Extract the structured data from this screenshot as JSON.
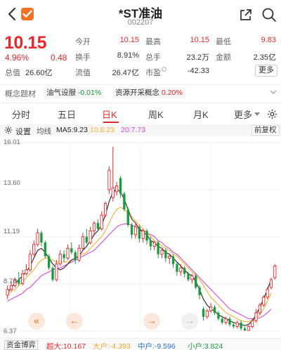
{
  "header": {
    "title": "*ST准油",
    "code": "002207"
  },
  "quote": {
    "price": "10.15",
    "change_pct": "4.96%",
    "change": "0.48",
    "market_cap_label": "总值",
    "market_cap": "26.60亿",
    "row1": [
      {
        "label": "今开",
        "value": "10.15",
        "color": "#e8282b"
      },
      {
        "label": "最高",
        "value": "10.15",
        "color": "#e8282b"
      },
      {
        "label": "最低",
        "value": "9.83",
        "color": "#e8282b"
      }
    ],
    "row2": [
      {
        "label": "换手",
        "value": "8.91%",
        "color": "#333"
      },
      {
        "label": "总手",
        "value": "23.2万",
        "color": "#333"
      },
      {
        "label": "金额",
        "value": "2.35亿",
        "color": "#333"
      }
    ],
    "row3": [
      {
        "label": "流值",
        "value": "26.47亿",
        "color": "#333"
      },
      {
        "label": "市盈",
        "value": "-42.33",
        "color": "#333"
      }
    ],
    "more": "更多"
  },
  "concepts": {
    "label": "概念题材",
    "items": [
      {
        "name": "油气设服",
        "change": "-0.01%"
      },
      {
        "name": "资源开采概念",
        "change": "0.20%"
      }
    ]
  },
  "tabs": [
    "分时",
    "五日",
    "日K",
    "周K",
    "月K",
    "更多"
  ],
  "active_tab": 2,
  "ma": {
    "settings": "设置",
    "label": "均线",
    "ma5": "MA5:9.23",
    "ma10": "10:8.23",
    "ma20": "20:7.73",
    "adjust": "前复权",
    "colors": {
      "ma5": "#222222",
      "ma10": "#f2b134",
      "ma20": "#d44ad8"
    }
  },
  "chart_data": {
    "type": "candlestick",
    "y_labels": [
      "16.01",
      "13.60",
      "11.19",
      "8.78",
      "6.37"
    ],
    "ylim": [
      6.37,
      16.01
    ],
    "candles": [
      {
        "o": 8.2,
        "c": 8.5,
        "h": 8.7,
        "l": 8.0
      },
      {
        "o": 8.5,
        "c": 8.7,
        "h": 8.9,
        "l": 8.4
      },
      {
        "o": 8.7,
        "c": 9.0,
        "h": 9.1,
        "l": 8.6
      },
      {
        "o": 9.0,
        "c": 8.8,
        "h": 9.4,
        "l": 8.7
      },
      {
        "o": 8.8,
        "c": 9.3,
        "h": 9.5,
        "l": 8.7
      },
      {
        "o": 9.3,
        "c": 9.5,
        "h": 9.8,
        "l": 9.2
      },
      {
        "o": 9.5,
        "c": 10.3,
        "h": 10.5,
        "l": 9.4
      },
      {
        "o": 10.3,
        "c": 10.8,
        "h": 11.0,
        "l": 10.2
      },
      {
        "o": 10.8,
        "c": 11.4,
        "h": 11.6,
        "l": 10.7
      },
      {
        "o": 11.4,
        "c": 10.9,
        "h": 11.5,
        "l": 10.7
      },
      {
        "o": 10.9,
        "c": 10.2,
        "h": 11.0,
        "l": 10.1
      },
      {
        "o": 10.2,
        "c": 9.6,
        "h": 10.3,
        "l": 9.5
      },
      {
        "o": 9.6,
        "c": 9.0,
        "h": 9.7,
        "l": 8.9
      },
      {
        "o": 9.0,
        "c": 9.8,
        "h": 10.0,
        "l": 8.9
      },
      {
        "o": 9.8,
        "c": 10.3,
        "h": 10.5,
        "l": 9.7
      },
      {
        "o": 10.3,
        "c": 10.1,
        "h": 10.5,
        "l": 9.9
      },
      {
        "o": 10.1,
        "c": 10.6,
        "h": 10.8,
        "l": 10.0
      },
      {
        "o": 10.6,
        "c": 10.4,
        "h": 10.9,
        "l": 10.3
      },
      {
        "o": 10.4,
        "c": 10.0,
        "h": 10.5,
        "l": 9.8
      },
      {
        "o": 10.0,
        "c": 10.6,
        "h": 10.8,
        "l": 9.9
      },
      {
        "o": 10.6,
        "c": 11.2,
        "h": 11.4,
        "l": 10.5
      },
      {
        "o": 11.2,
        "c": 10.9,
        "h": 11.6,
        "l": 10.8
      },
      {
        "o": 10.9,
        "c": 11.5,
        "h": 11.7,
        "l": 10.8
      },
      {
        "o": 11.5,
        "c": 11.9,
        "h": 12.0,
        "l": 11.3
      },
      {
        "o": 11.9,
        "c": 11.6,
        "h": 12.1,
        "l": 11.5
      },
      {
        "o": 11.6,
        "c": 12.3,
        "h": 12.5,
        "l": 11.5
      },
      {
        "o": 12.3,
        "c": 12.9,
        "h": 13.0,
        "l": 12.2
      },
      {
        "o": 13.6,
        "c": 14.6,
        "h": 14.8,
        "l": 13.4
      },
      {
        "o": 13.2,
        "c": 13.7,
        "h": 15.8,
        "l": 13.0
      },
      {
        "o": 13.5,
        "c": 13.8,
        "h": 14.0,
        "l": 13.3
      },
      {
        "o": 14.2,
        "c": 13.4,
        "h": 14.3,
        "l": 13.2
      },
      {
        "o": 13.4,
        "c": 12.6,
        "h": 13.5,
        "l": 12.5
      },
      {
        "o": 12.6,
        "c": 11.8,
        "h": 12.7,
        "l": 11.7
      },
      {
        "o": 11.8,
        "c": 11.3,
        "h": 11.9,
        "l": 11.1
      },
      {
        "o": 11.3,
        "c": 11.7,
        "h": 11.9,
        "l": 11.1
      },
      {
        "o": 11.7,
        "c": 11.1,
        "h": 11.8,
        "l": 10.9
      },
      {
        "o": 11.1,
        "c": 11.5,
        "h": 11.6,
        "l": 10.9
      },
      {
        "o": 11.5,
        "c": 11.0,
        "h": 11.6,
        "l": 10.8
      },
      {
        "o": 11.0,
        "c": 10.7,
        "h": 11.2,
        "l": 10.5
      },
      {
        "o": 10.7,
        "c": 10.9,
        "h": 11.0,
        "l": 10.5
      },
      {
        "o": 10.9,
        "c": 10.3,
        "h": 11.0,
        "l": 10.1
      },
      {
        "o": 10.3,
        "c": 10.5,
        "h": 10.6,
        "l": 10.1
      },
      {
        "o": 10.5,
        "c": 10.1,
        "h": 10.6,
        "l": 9.9
      },
      {
        "o": 10.1,
        "c": 10.2,
        "h": 10.3,
        "l": 9.8
      },
      {
        "o": 10.2,
        "c": 9.8,
        "h": 10.3,
        "l": 9.6
      },
      {
        "o": 9.8,
        "c": 9.4,
        "h": 9.9,
        "l": 9.2
      },
      {
        "o": 9.4,
        "c": 9.6,
        "h": 9.8,
        "l": 9.2
      },
      {
        "o": 9.6,
        "c": 9.3,
        "h": 9.7,
        "l": 9.1
      },
      {
        "o": 9.3,
        "c": 9.0,
        "h": 9.4,
        "l": 8.9
      },
      {
        "o": 9.0,
        "c": 9.2,
        "h": 9.3,
        "l": 8.8
      },
      {
        "o": 9.2,
        "c": 8.6,
        "h": 9.3,
        "l": 8.5
      },
      {
        "o": 8.6,
        "c": 8.2,
        "h": 8.7,
        "l": 8.0
      },
      {
        "o": 7.5,
        "c": 7.1,
        "h": 7.6,
        "l": 6.9
      },
      {
        "o": 7.1,
        "c": 7.4,
        "h": 7.5,
        "l": 7.0
      },
      {
        "o": 7.4,
        "c": 7.6,
        "h": 7.8,
        "l": 7.3
      },
      {
        "o": 7.6,
        "c": 7.3,
        "h": 7.7,
        "l": 7.2
      },
      {
        "o": 7.3,
        "c": 7.0,
        "h": 7.4,
        "l": 6.9
      },
      {
        "o": 7.0,
        "c": 6.8,
        "h": 7.1,
        "l": 6.7
      },
      {
        "o": 6.8,
        "c": 7.0,
        "h": 7.1,
        "l": 6.7
      },
      {
        "o": 7.0,
        "c": 6.7,
        "h": 7.1,
        "l": 6.6
      },
      {
        "o": 6.7,
        "c": 6.6,
        "h": 6.8,
        "l": 6.5
      },
      {
        "o": 6.6,
        "c": 6.8,
        "h": 6.9,
        "l": 6.5
      },
      {
        "o": 6.8,
        "c": 6.5,
        "h": 6.9,
        "l": 6.4
      },
      {
        "o": 6.5,
        "c": 6.4,
        "h": 6.6,
        "l": 6.37
      },
      {
        "o": 6.4,
        "c": 6.6,
        "h": 6.7,
        "l": 6.4
      },
      {
        "o": 6.6,
        "c": 6.9,
        "h": 7.0,
        "l": 6.5
      },
      {
        "o": 6.9,
        "c": 7.3,
        "h": 7.5,
        "l": 6.8
      },
      {
        "o": 7.3,
        "c": 7.7,
        "h": 7.8,
        "l": 7.2
      },
      {
        "o": 7.7,
        "c": 8.1,
        "h": 8.2,
        "l": 7.6
      },
      {
        "o": 8.1,
        "c": 8.5,
        "h": 8.6,
        "l": 8.0
      },
      {
        "o": 8.6,
        "c": 9.0,
        "h": 9.1,
        "l": 8.5
      },
      {
        "o": 9.1,
        "c": 9.7,
        "h": 9.8,
        "l": 9.0
      }
    ],
    "ma5": [
      8.3,
      8.6,
      8.8,
      9.0,
      9.2,
      9.4,
      9.7,
      10.1,
      10.5,
      10.6,
      10.4,
      10.1,
      9.8,
      9.6,
      9.5,
      9.6,
      9.8,
      10.0,
      10.1,
      10.2,
      10.5,
      10.7,
      11.0,
      11.3,
      11.5,
      11.8,
      12.3,
      13.0,
      13.5,
      13.6,
      13.5,
      13.1,
      12.6,
      12.1,
      11.9,
      11.6,
      11.4,
      11.3,
      11.0,
      10.9,
      10.7,
      10.6,
      10.4,
      10.3,
      10.1,
      9.9,
      9.7,
      9.5,
      9.3,
      9.2,
      8.9,
      8.5,
      8.0,
      7.7,
      7.5,
      7.4,
      7.2,
      7.1,
      7.0,
      6.9,
      6.8,
      6.75,
      6.7,
      6.65,
      6.7,
      6.9,
      7.2,
      7.6,
      8.0,
      8.5,
      9.0
    ],
    "ma10": [
      8.2,
      8.4,
      8.5,
      8.7,
      8.9,
      9.1,
      9.3,
      9.5,
      9.8,
      10.0,
      10.1,
      10.1,
      10.0,
      9.9,
      9.9,
      9.9,
      9.9,
      10.0,
      10.1,
      10.2,
      10.3,
      10.4,
      10.6,
      10.8,
      11.0,
      11.2,
      11.5,
      11.9,
      12.3,
      12.6,
      12.7,
      12.6,
      12.4,
      12.2,
      12.0,
      11.8,
      11.6,
      11.4,
      11.2,
      11.0,
      10.9,
      10.7,
      10.6,
      10.5,
      10.3,
      10.2,
      10.0,
      9.8,
      9.6,
      9.4,
      9.2,
      9.0,
      8.7,
      8.4,
      8.1,
      7.9,
      7.7,
      7.5,
      7.3,
      7.2,
      7.1,
      7.0,
      6.9,
      6.85,
      6.85,
      6.9,
      7.0,
      7.2,
      7.5,
      7.9,
      8.3
    ],
    "ma20": [
      7.9,
      8.0,
      8.1,
      8.2,
      8.3,
      8.5,
      8.6,
      8.8,
      9.0,
      9.2,
      9.3,
      9.4,
      9.5,
      9.6,
      9.6,
      9.7,
      9.8,
      9.9,
      10.0,
      10.1,
      10.2,
      10.3,
      10.4,
      10.5,
      10.7,
      10.9,
      11.1,
      11.3,
      11.5,
      11.7,
      11.8,
      11.85,
      11.85,
      11.8,
      11.7,
      11.6,
      11.5,
      11.4,
      11.3,
      11.2,
      11.0,
      10.9,
      10.7,
      10.6,
      10.4,
      10.3,
      10.1,
      9.9,
      9.7,
      9.5,
      9.3,
      9.1,
      8.9,
      8.7,
      8.5,
      8.3,
      8.1,
      7.9,
      7.7,
      7.5,
      7.4,
      7.3,
      7.2,
      7.1,
      7.0,
      7.0,
      7.0,
      7.05,
      7.15,
      7.3,
      7.5
    ]
  },
  "controls": [
    "«",
    "←",
    "→",
    "→"
  ],
  "fund_flow": {
    "tag": "资金博弈",
    "items": [
      {
        "label": "超大:",
        "value": "10.167",
        "color": "#e8282b"
      },
      {
        "label": "大户:",
        "value": "-4.393",
        "color": "#f2a530"
      },
      {
        "label": "中户:",
        "value": "-9.596",
        "color": "#2a6fd8"
      },
      {
        "label": "小户:",
        "value": "3.824",
        "color": "#1a9a3c"
      }
    ]
  }
}
